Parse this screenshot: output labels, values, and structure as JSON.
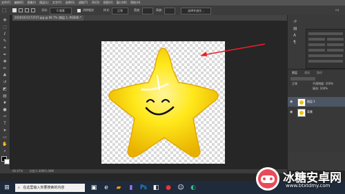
{
  "menubar": {
    "items": [
      "文件(F)",
      "编辑(E)",
      "图像(I)",
      "图层(L)",
      "文字(Y)",
      "选择(S)",
      "滤镜(T)",
      "3D(D)",
      "视图(V)",
      "窗口(W)",
      "帮助(H)"
    ]
  },
  "options": {
    "feather_label": "羽化:",
    "feather_value": "0 像素",
    "antialias_label": "消除锯齿",
    "style_label": "样式:",
    "style_value": "正常",
    "width_label": "宽度:",
    "height_label": "高度:",
    "select_mask_label": "选择并遮住..."
  },
  "tab": {
    "label": "20201031173737.jpg @ 66.7% (图层 1, RGB/8) *"
  },
  "status": {
    "zoom": "66.67%",
    "doc_info": "文档:1.44M/1.08M"
  },
  "layers": {
    "tabs": [
      "图层",
      "通道",
      "路径"
    ],
    "mode": "正常",
    "opacity": "不透明度: 100%",
    "fill": "填充: 100%",
    "items": [
      {
        "name": "图层 1",
        "visible": true,
        "selected": true
      },
      {
        "name": "背景",
        "visible": true,
        "selected": false
      }
    ]
  },
  "taskbar": {
    "search_placeholder": "在这里输入你要搜索的内容"
  },
  "watermark": {
    "text": "冰糖安卓网",
    "url": "www.btxtdmy.com"
  },
  "colors": {
    "star_outer": "#f0c000",
    "star_inner": "#ffef30",
    "arrow": "#e8202a",
    "taskbar": "#1f2a3a"
  }
}
